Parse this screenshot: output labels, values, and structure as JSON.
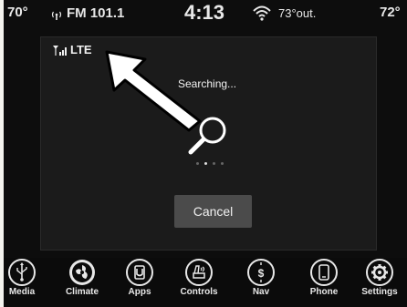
{
  "status_bar": {
    "left_temp": "70°",
    "radio": "FM 101.1",
    "clock": "4:13",
    "outside_temp": "73°out.",
    "right_temp": "72°"
  },
  "panel": {
    "signal_label": "LTE",
    "searching_text": "Searching...",
    "progress_dots_total": 4,
    "progress_dot_active": 2,
    "cancel_label": "Cancel"
  },
  "nav": {
    "items": [
      {
        "label": "Media",
        "icon": "usb-icon"
      },
      {
        "label": "Climate",
        "icon": "climate-icon"
      },
      {
        "label": "Apps",
        "icon": "apps-icon"
      },
      {
        "label": "Controls",
        "icon": "controls-icon"
      },
      {
        "label": "Nav",
        "icon": "nav-icon"
      },
      {
        "label": "Phone",
        "icon": "phone-icon"
      },
      {
        "label": "Settings",
        "icon": "settings-icon"
      }
    ]
  },
  "colors": {
    "background": "#0d0d0d",
    "panel": "#1b1b1b",
    "button": "#4b4b4b",
    "text": "#f0f0f0"
  }
}
